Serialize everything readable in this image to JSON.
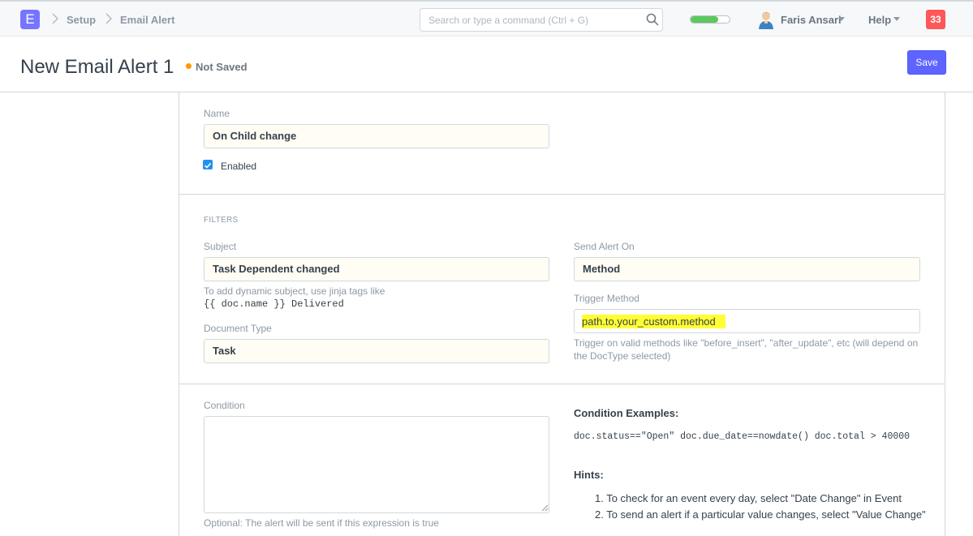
{
  "navbar": {
    "logo_letter": "E",
    "breadcrumbs": [
      "Setup",
      "Email Alert"
    ],
    "search_placeholder": "Search or type a command (Ctrl + G)",
    "progress_fraction": 0.7,
    "user_name": "Faris Ansari",
    "help_label": "Help",
    "notification_count": "33"
  },
  "page": {
    "title": "New Email Alert 1",
    "status": "Not Saved",
    "save_label": "Save"
  },
  "form": {
    "name_label": "Name",
    "name_value": "On Child change",
    "enabled_label": "Enabled",
    "filters_heading": "FILTERS",
    "subject_label": "Subject",
    "subject_value": "Task Dependent changed",
    "subject_help_1": "To add dynamic subject, use jinja tags like",
    "subject_help_2": "{{ doc.name }} Delivered",
    "doctype_label": "Document Type",
    "doctype_value": "Task",
    "send_alert_label": "Send Alert On",
    "send_alert_value": "Method",
    "trigger_label": "Trigger Method",
    "trigger_value": "path.to.your_custom.method",
    "trigger_help": "Trigger on valid methods like \"before_insert\", \"after_update\", etc (will depend on the DocType selected)",
    "condition_label": "Condition",
    "condition_help": "Optional: The alert will be sent if this expression is true",
    "examples_title": "Condition Examples:",
    "examples_code": "doc.status==\"Open\" doc.due_date==nowdate() doc.total > 40000",
    "hints_title": "Hints:",
    "hints": [
      "1. To check for an event every day, select \"Date Change\" in Event",
      "2. To send an alert if a particular value changes, select \"Value Change\""
    ]
  },
  "colors": {
    "accent": "#5e64ff",
    "unsaved": "#ff9800",
    "badge": "#ff5858",
    "highlight": "#ffff33"
  }
}
